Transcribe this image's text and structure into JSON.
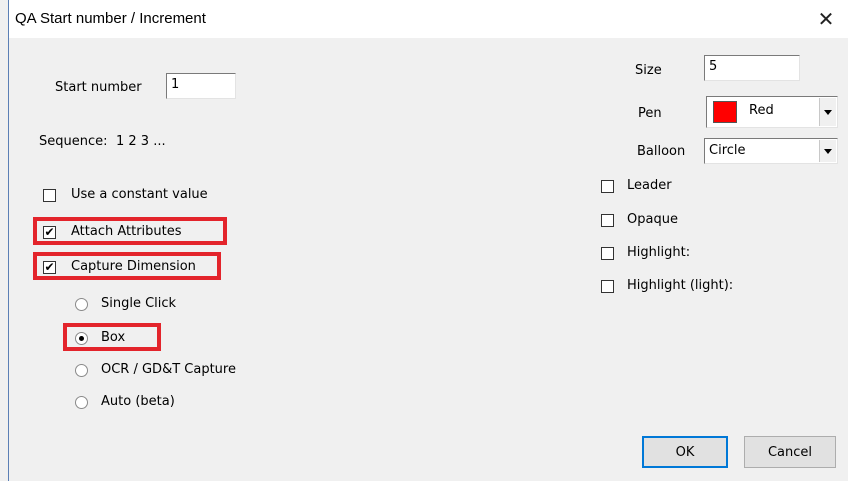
{
  "window": {
    "title": "QA Start number / Increment",
    "close": "✕"
  },
  "start": {
    "label": "Start number",
    "value": "1"
  },
  "sequence": {
    "label": "Sequence:",
    "value": "1 2 3 ..."
  },
  "options": {
    "constant": {
      "label": "Use a constant value",
      "checked": false
    },
    "attach": {
      "label": "Attach Attributes",
      "checked": true
    },
    "capture": {
      "label": "Capture Dimension",
      "checked": true
    }
  },
  "capture_modes": [
    {
      "label": "Single Click",
      "selected": false
    },
    {
      "label": "Box",
      "selected": true
    },
    {
      "label": "OCR / GD&T Capture",
      "selected": false
    },
    {
      "label": "Auto (beta)",
      "selected": false
    }
  ],
  "size": {
    "label": "Size",
    "value": "5"
  },
  "pen": {
    "label": "Pen",
    "value": "Red",
    "swatch_color": "#ff0000"
  },
  "balloon": {
    "label": "Balloon",
    "value": "Circle"
  },
  "right_options": [
    {
      "label": "Leader",
      "checked": false
    },
    {
      "label": "Opaque",
      "checked": false
    },
    {
      "label": "Highlight:",
      "checked": false
    },
    {
      "label": "Highlight (light):",
      "checked": false
    }
  ],
  "buttons": {
    "ok": "OK",
    "cancel": "Cancel"
  },
  "colors": {
    "highlight": "#e3242b",
    "default_button_border": "#0078d7"
  }
}
